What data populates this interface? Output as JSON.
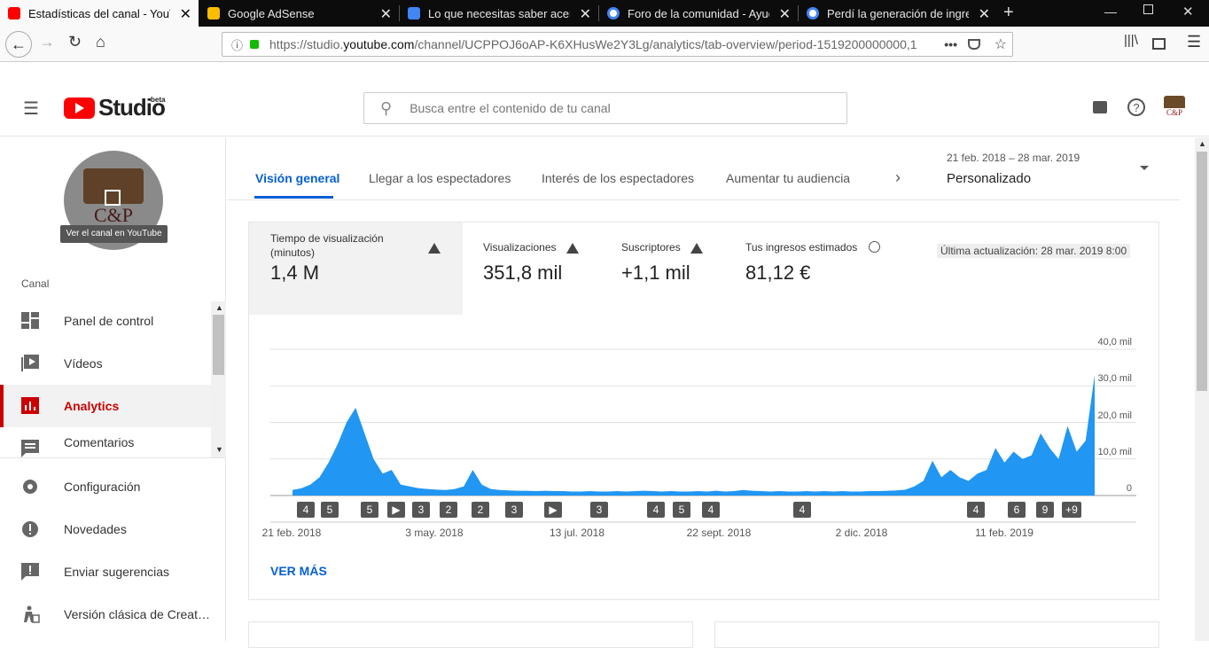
{
  "browser": {
    "tabs": [
      {
        "title": "Estadísticas del canal - YouTube",
        "active": true,
        "favicon_color": "#ff0000"
      },
      {
        "title": "Google AdSense",
        "active": false,
        "favicon_color": "#fbbc04"
      },
      {
        "title": "Lo que necesitas saber acerca d",
        "active": false,
        "favicon_color": "#4285f4"
      },
      {
        "title": "Foro de la comunidad - Ayuda",
        "active": false,
        "favicon_color": "#4285f4"
      },
      {
        "title": "Perdí la generación de ingresos",
        "active": false,
        "favicon_color": "#4285f4"
      }
    ],
    "url_prefix": "https://studio.",
    "url_domain": "youtube.com",
    "url_rest": "/channel/UCPPOJ6oAP-K6XHusWe2Y3Lg/analytics/tab-overview/period-1519200000000,1"
  },
  "studio": {
    "logo_text": "Studio",
    "logo_badge": "beta",
    "search_placeholder": "Busca entre el contenido de tu canal",
    "avatar_text": "C&P"
  },
  "sidebar": {
    "channel_overlay": "Ver el canal en YouTube",
    "section_label": "Canal",
    "items": [
      {
        "label": "Panel de control",
        "icon": "dashboard-icon"
      },
      {
        "label": "Vídeos",
        "icon": "video-icon"
      },
      {
        "label": "Analytics",
        "icon": "analytics-icon",
        "active": true
      },
      {
        "label": "Comentarios",
        "icon": "comments-icon"
      }
    ],
    "bottom_items": [
      {
        "label": "Configuración",
        "icon": "gear-icon"
      },
      {
        "label": "Novedades",
        "icon": "alert-icon"
      },
      {
        "label": "Enviar sugerencias",
        "icon": "feedback-icon"
      },
      {
        "label": "Versión clásica de Creat…",
        "icon": "classic-icon"
      }
    ]
  },
  "analytics": {
    "tabs": [
      "Visión general",
      "Llegar a los espectadores",
      "Interés de los espectadores",
      "Aumentar tu audiencia"
    ],
    "date_range": "21 feb. 2018 – 28 mar. 2019",
    "period_label": "Personalizado",
    "last_update": "Última actualización: 28 mar. 2019 8:00",
    "metrics": [
      {
        "title": "Tiempo de visualización (minutos)",
        "value": "1,4 M",
        "icon": "warning-icon"
      },
      {
        "title": "Visualizaciones",
        "value": "351,8 mil",
        "icon": "warning-icon"
      },
      {
        "title": "Suscriptores",
        "value": "+1,1 mil",
        "icon": "warning-icon"
      },
      {
        "title": "Tus ingresos estimados",
        "value": "81,12 €",
        "icon": "clock-icon"
      }
    ],
    "see_more": "VER MÁS"
  },
  "chart_data": {
    "type": "area",
    "series_color": "#2196f3",
    "y_ticks": [
      "0",
      "10,0 mil",
      "20,0 mil",
      "30,0 mil",
      "40,0 mil"
    ],
    "ylim": [
      0,
      40000
    ],
    "x_ticks": [
      "21 feb. 2018",
      "3 may. 2018",
      "13 jul. 2018",
      "22 sept. 2018",
      "2 dic. 2018",
      "11 feb. 2019"
    ],
    "values": [
      1500,
      2000,
      3000,
      5000,
      9000,
      14000,
      20000,
      24000,
      17000,
      10000,
      6000,
      7000,
      3000,
      2500,
      2000,
      1800,
      1600,
      1500,
      1800,
      2500,
      7000,
      3000,
      1800,
      1500,
      1400,
      1300,
      1300,
      1200,
      1300,
      1200,
      1200,
      1100,
      1100,
      1200,
      1100,
      1100,
      1200,
      1100,
      1200,
      1300,
      1200,
      1100,
      1200,
      1100,
      1100,
      1200,
      1100,
      1300,
      1100,
      1200,
      1500,
      1300,
      1200,
      1100,
      1200,
      1100,
      1100,
      1200,
      1100,
      1200,
      1100,
      1200,
      1100,
      1100,
      1200,
      1200,
      1300,
      1400,
      1600,
      2500,
      4000,
      9500,
      5000,
      7000,
      5000,
      4000,
      6000,
      7000,
      13000,
      9000,
      12000,
      10000,
      11000,
      17000,
      13000,
      10000,
      19000,
      12000,
      15000,
      33000
    ],
    "annotations": [
      "4",
      "5",
      "5",
      "▶",
      "3",
      "2",
      "2",
      "3",
      "▶",
      "3",
      "4",
      "5",
      "4",
      "4",
      "4",
      "6",
      "9",
      "+9"
    ]
  }
}
